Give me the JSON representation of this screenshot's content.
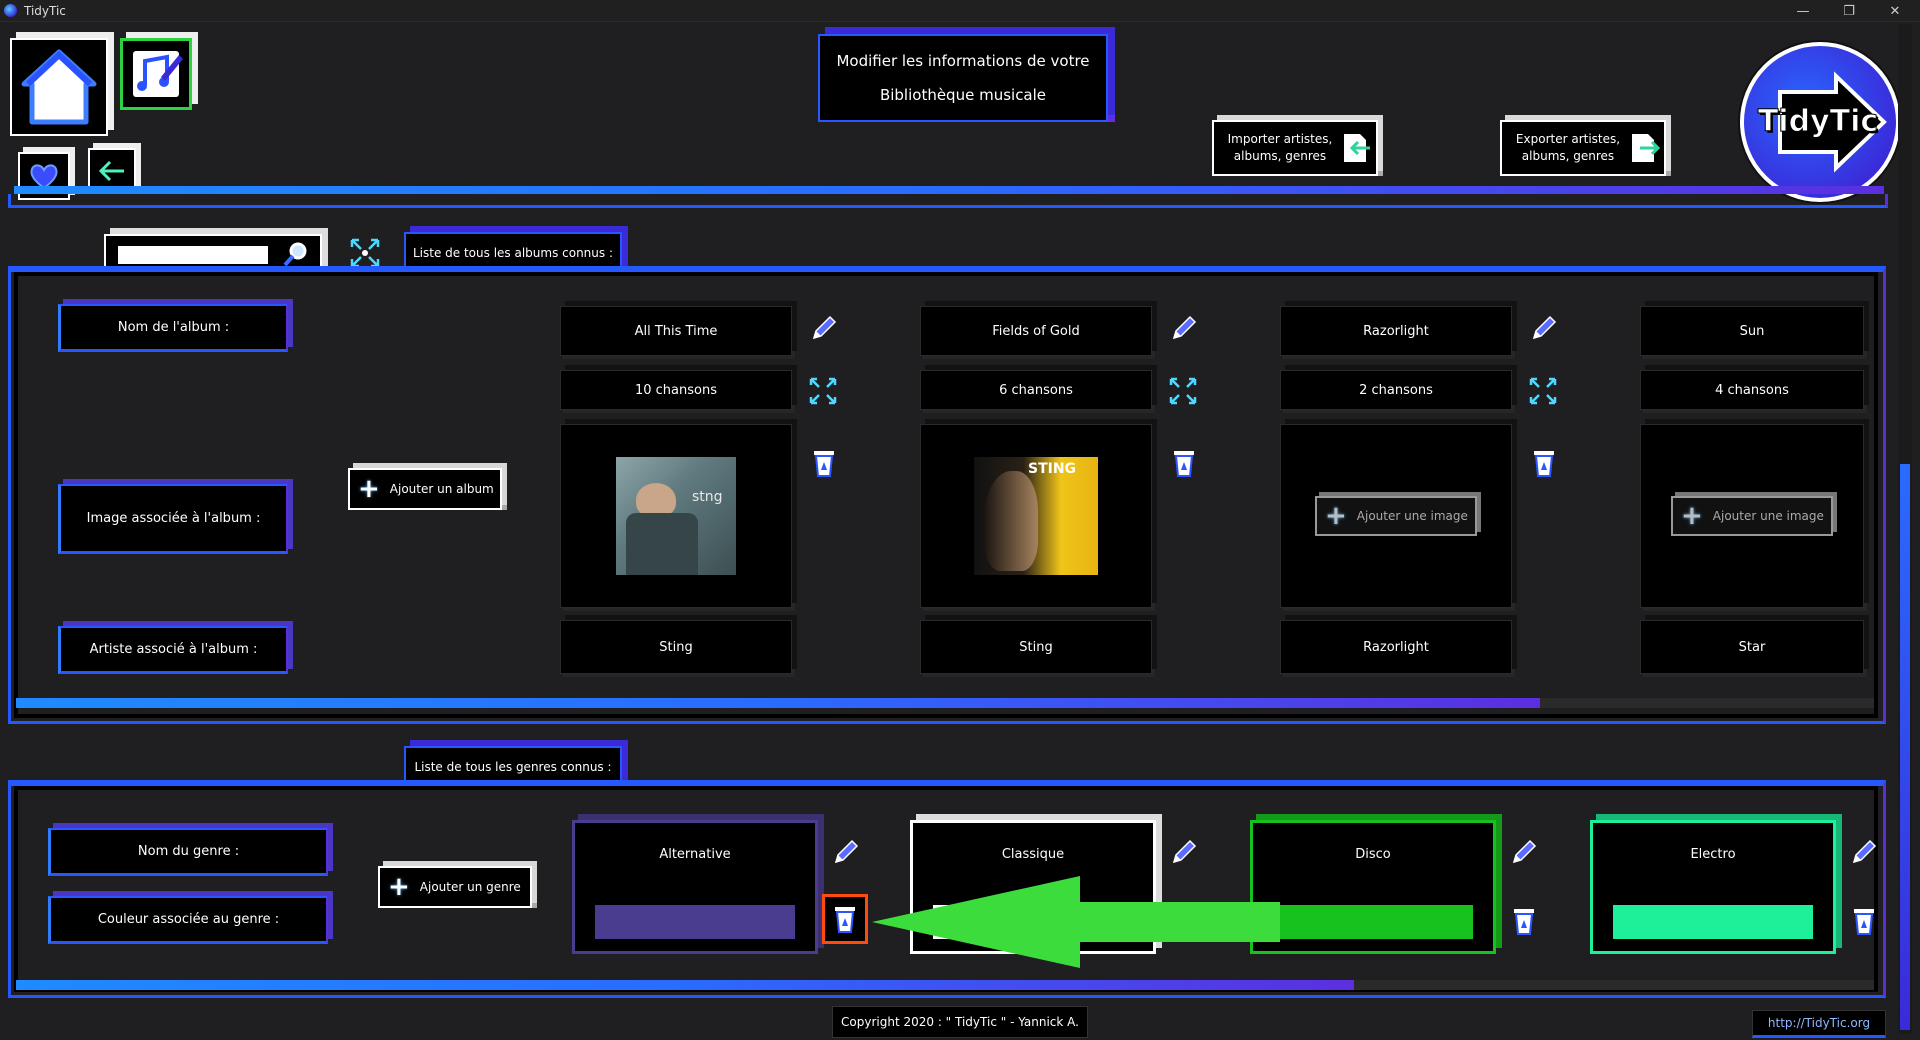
{
  "window": {
    "title": "TidyTic",
    "minimize": "—",
    "maximize": "❐",
    "close": "✕"
  },
  "header": {
    "title_line1": "Modifier les informations de votre",
    "title_line2": "Bibliothèque musicale",
    "import_label_1": "Importer artistes,",
    "import_label_2": "albums, genres",
    "export_label_1": "Exporter artistes,",
    "export_label_2": "albums, genres",
    "logo_text": "TidyTic"
  },
  "search": {
    "value": "",
    "placeholder": ""
  },
  "albums": {
    "section_title": "Liste de tous les albums connus :",
    "label_name": "Nom de l'album :",
    "label_image": "Image associée à l'album :",
    "label_artist": "Artiste associé à l'album :",
    "add_album": "Ajouter un album",
    "add_image": "Ajouter une image",
    "items": [
      {
        "name": "All This Time",
        "songs": "10 chansons",
        "artist": "Sting",
        "cover_text": "stng"
      },
      {
        "name": "Fields of Gold",
        "songs": "6 chansons",
        "artist": "Sting",
        "cover_text": "STING"
      },
      {
        "name": "Razorlight",
        "songs": "2 chansons",
        "artist": "Razorlight"
      },
      {
        "name": "Sun",
        "songs": "4 chansons",
        "artist": "Star"
      }
    ],
    "scroll_fraction": 0.82
  },
  "genres": {
    "section_title": "Liste de tous les genres connus :",
    "label_name": "Nom du genre :",
    "label_color": "Couleur associée au genre :",
    "add_genre": "Ajouter un genre",
    "items": [
      {
        "name": "Alternative",
        "color": "#4a3d8f",
        "border": "#4a3d8f"
      },
      {
        "name": "Classique",
        "color": "#ffffff",
        "border": "#ffffff"
      },
      {
        "name": "Disco",
        "color": "#17c21e",
        "border": "#17c21e"
      },
      {
        "name": "Electro",
        "color": "#1ef09a",
        "border": "#1ef09a"
      }
    ],
    "scroll_fraction": 0.72
  },
  "footer": {
    "copyright": "Copyright 2020 : \" TidyTic \" - Yannick A.",
    "link": "http://TidyTic.org"
  },
  "colors": {
    "accent_blue": "#2559ff",
    "accent_purple": "#5b2fd6",
    "highlight_orange": "#ff4a10",
    "arrow_green": "#3ddc3d"
  }
}
